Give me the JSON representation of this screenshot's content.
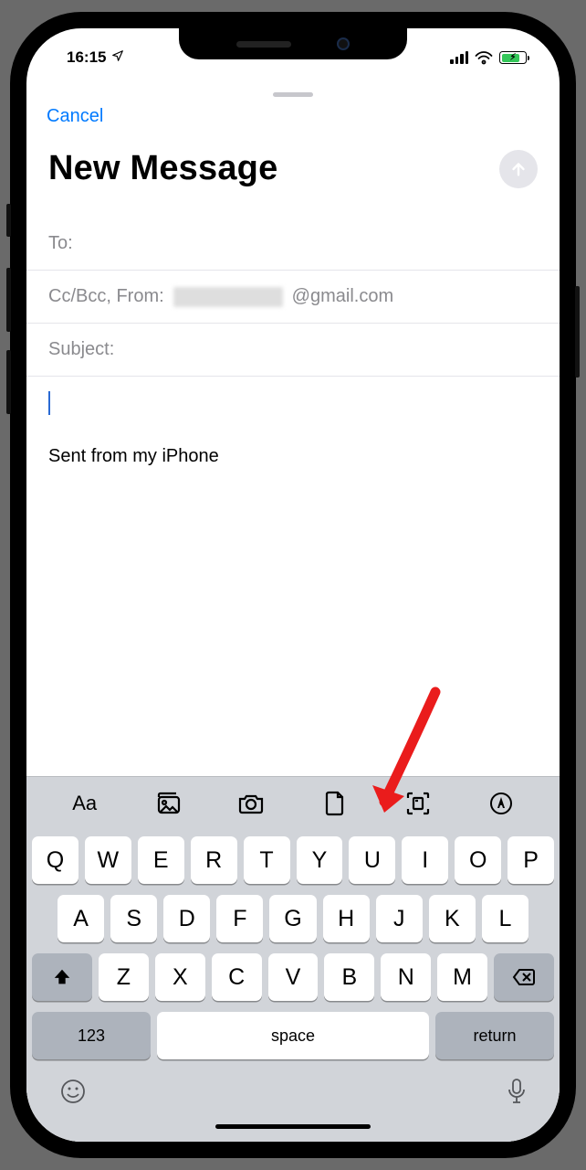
{
  "status": {
    "time": "16:15"
  },
  "compose": {
    "cancel": "Cancel",
    "title": "New Message",
    "to_label": "To:",
    "ccbcc_from_label": "Cc/Bcc, From:",
    "from_domain": "@gmail.com",
    "subject_label": "Subject:",
    "signature": "Sent from my iPhone"
  },
  "toolbar": {
    "text_format": "Aa"
  },
  "keyboard": {
    "row1": [
      "Q",
      "W",
      "E",
      "R",
      "T",
      "Y",
      "U",
      "I",
      "O",
      "P"
    ],
    "row2": [
      "A",
      "S",
      "D",
      "F",
      "G",
      "H",
      "J",
      "K",
      "L"
    ],
    "row3": [
      "Z",
      "X",
      "C",
      "V",
      "B",
      "N",
      "M"
    ],
    "numbers": "123",
    "space": "space",
    "return": "return"
  }
}
